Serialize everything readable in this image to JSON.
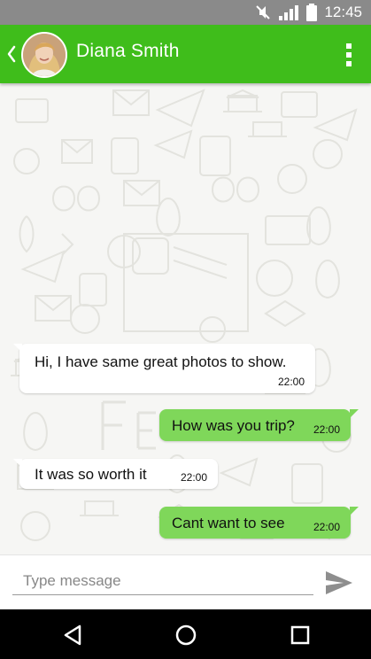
{
  "status_bar": {
    "time": "12:45",
    "icons": [
      "mute-icon",
      "signal-icon",
      "battery-icon"
    ]
  },
  "header": {
    "contact_name": "Diana Smith",
    "back_icon": "chevron-left-icon",
    "menu_icon": "more-vert-icon",
    "avatar": "contact-avatar"
  },
  "messages": [
    {
      "direction": "incoming",
      "text": "Hi, I have same great photos to show.",
      "time": "22:00"
    },
    {
      "direction": "outgoing",
      "text": "How was you trip?",
      "time": "22:00"
    },
    {
      "direction": "incoming",
      "text": "It was so worth it",
      "time": "22:00"
    },
    {
      "direction": "outgoing",
      "text": "Cant want to see",
      "time": "22:00"
    }
  ],
  "composer": {
    "placeholder": "Type message",
    "value": "",
    "send_icon": "send-icon"
  },
  "nav": {
    "back": "nav-back-icon",
    "home": "nav-home-icon",
    "recents": "nav-recents-icon"
  },
  "colors": {
    "appbar": "#3fbd1b",
    "outgoing_bubble": "#7fd75a",
    "incoming_bubble": "#ffffff",
    "background": "#f6f6f4"
  }
}
